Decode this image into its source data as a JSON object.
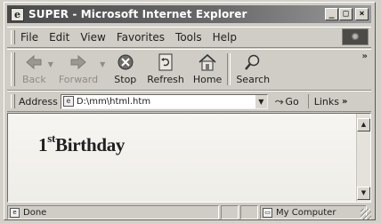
{
  "window": {
    "title": "SUPER - Microsoft Internet Explorer",
    "title_icon": "e",
    "controls": {
      "minimize": "_",
      "maximize": "□",
      "close": "×"
    }
  },
  "menu": {
    "items": [
      {
        "key": "file",
        "label": "File"
      },
      {
        "key": "edit",
        "label": "Edit"
      },
      {
        "key": "view",
        "label": "View"
      },
      {
        "key": "favorites",
        "label": "Favorites"
      },
      {
        "key": "tools",
        "label": "Tools"
      },
      {
        "key": "help",
        "label": "Help"
      }
    ]
  },
  "toolbar": {
    "back_label": "Back",
    "forward_label": "Forward",
    "stop_label": "Stop",
    "refresh_label": "Refresh",
    "home_label": "Home",
    "search_label": "Search",
    "more": "»"
  },
  "address": {
    "label": "Address",
    "value": "D:\\mm\\html.htm",
    "go_label": "Go",
    "links_label": "Links",
    "links_more": "»"
  },
  "page": {
    "heading_num": "1",
    "heading_sup": "st",
    "heading_text": "Birthday"
  },
  "status": {
    "text": "Done",
    "zone": "My Computer"
  },
  "colors": {
    "titlebar": "#4a4a4a",
    "chrome": "#cfcdc5",
    "content_bg": "#f4f3ef"
  }
}
